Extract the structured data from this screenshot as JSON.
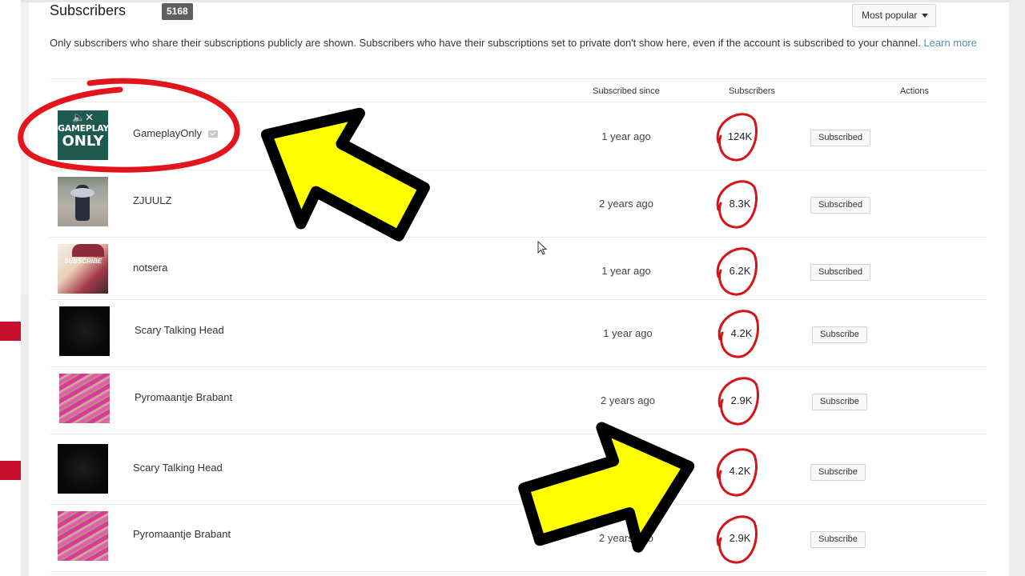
{
  "header": {
    "title": "Subscribers",
    "count": "5168",
    "sort_label": "Most popular",
    "info_text": "Only subscribers who share their subscriptions publicly are shown. Subscribers who have their subscriptions set to private don't show here, even if the account is subscribed to your channel. ",
    "learn_more": "Learn more"
  },
  "table": {
    "columns": [
      "Subscribed since",
      "Subscribers",
      "Actions"
    ],
    "rows": [
      {
        "name": "GameplayOnly",
        "verified": true,
        "avatar": "gameplay-only-logo",
        "avatar_text_1": "GAMEPLAY",
        "avatar_text_2": "ONLY",
        "since": "1 year ago",
        "subscribers": "124K",
        "action": "Subscribed"
      },
      {
        "name": "ZJUULZ",
        "verified": false,
        "avatar": "motorcycle-photo",
        "since": "2 years ago",
        "subscribers": "8.3K",
        "action": "Subscribed"
      },
      {
        "name": "notsera",
        "verified": false,
        "avatar": "girl-selfie-photo",
        "avatar_text": "SUBSCRIBE",
        "since": "1 year ago",
        "subscribers": "6.2K",
        "action": "Subscribed"
      },
      {
        "name": "Scary Talking Head",
        "verified": false,
        "avatar": "dark-face-photo",
        "since": "1 year ago",
        "subscribers": "4.2K",
        "action": "Subscribe"
      },
      {
        "name": "Pyromaantje Brabant",
        "verified": false,
        "avatar": "fireworks-photo",
        "since": "2 years ago",
        "subscribers": "2.9K",
        "action": "Subscribe"
      },
      {
        "name": "Scary Talking Head",
        "verified": false,
        "avatar": "dark-face-photo",
        "since": "",
        "subscribers": "4.2K",
        "action": "Subscribe"
      },
      {
        "name": "Pyromaantje Brabant",
        "verified": false,
        "avatar": "fireworks-photo",
        "since": "2 years ago",
        "subscribers": "2.9K",
        "action": "Subscribe"
      }
    ]
  },
  "annotations": {
    "circle_color": "#e3141b",
    "arrow_fill": "#ffff00",
    "arrow_outline": "#000000",
    "items": [
      "red-ellipse-around-gameplayonly",
      "yellow-arrow-pointing-up-left",
      "yellow-arrow-pointing-right",
      "red-circles-around-subscriber-counts"
    ]
  },
  "colors": {
    "badge_bg": "#5f5f5f",
    "link": "#5a8fa8",
    "side_marker": "#c8102e"
  }
}
